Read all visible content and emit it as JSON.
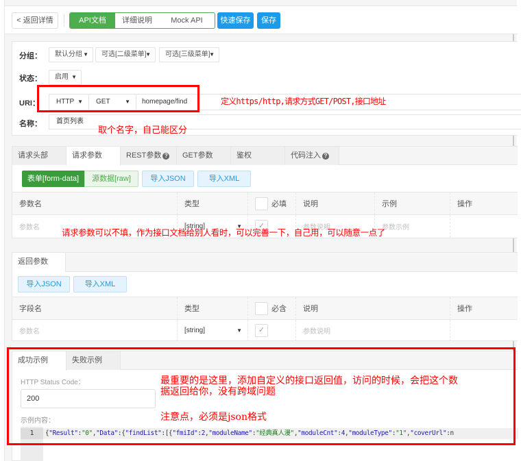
{
  "toolbar": {
    "back_label": "< 返回详情",
    "tabs": [
      {
        "label": "API文档",
        "active": true
      },
      {
        "label": "详细说明",
        "active": false
      },
      {
        "label": "Mock API",
        "active": false
      }
    ],
    "quick_save_label": "快速保存",
    "save_label": "保存"
  },
  "form": {
    "group_label": "分组：",
    "group_selects": [
      "默认分组",
      "可选[二级菜单]",
      "可选[三级菜单]"
    ],
    "status_label": "状态：",
    "status_value": "启用",
    "uri_label": "URI：",
    "protocol": "HTTP",
    "method": "GET",
    "path": "homepage/find",
    "name_label": "名称：",
    "name_value": "首页列表"
  },
  "request": {
    "tabs": [
      {
        "label": "请求头部",
        "help": false,
        "active": false
      },
      {
        "label": "请求参数",
        "help": false,
        "active": true
      },
      {
        "label": "REST参数",
        "help": true,
        "active": false
      },
      {
        "label": "GET参数",
        "help": false,
        "active": false
      },
      {
        "label": "鉴权",
        "help": false,
        "active": false
      },
      {
        "label": "代码注入",
        "help": true,
        "active": false
      }
    ],
    "help_glyph": "?",
    "form_data_label": "表单[form-data]",
    "raw_label": "源数据[raw]",
    "import_json_label": "导入JSON",
    "import_xml_label": "导入XML",
    "columns": [
      "参数名",
      "类型",
      "必填",
      "说明",
      "示例",
      "操作"
    ],
    "row": {
      "name_placeholder": "参数名",
      "type": "[string]",
      "required_check": "✓",
      "desc_placeholder": "参数说明",
      "example_placeholder": "参数示例"
    }
  },
  "response": {
    "tab_label": "返回参数",
    "import_json_label": "导入JSON",
    "import_xml_label": "导入XML",
    "columns": [
      "字段名",
      "类型",
      "必含",
      "说明",
      "操作"
    ],
    "row": {
      "name_placeholder": "参数名",
      "type": "[string]",
      "required_check": "✓",
      "desc_placeholder": "参数说明"
    }
  },
  "example": {
    "tabs": [
      {
        "label": "成功示例",
        "active": true
      },
      {
        "label": "失败示例",
        "active": false
      }
    ],
    "status_code_label": "HTTP Status Code：",
    "status_code_value": "200",
    "content_label": "示例内容：",
    "line_number": "1",
    "code_tokens": [
      {
        "t": "{",
        "c": "pun"
      },
      {
        "t": "\"Result\"",
        "c": "key"
      },
      {
        "t": ":",
        "c": "pun"
      },
      {
        "t": "\"0\"",
        "c": "str"
      },
      {
        "t": ",",
        "c": "pun"
      },
      {
        "t": "\"Data\"",
        "c": "key"
      },
      {
        "t": ":{",
        "c": "pun"
      },
      {
        "t": "\"findList\"",
        "c": "key"
      },
      {
        "t": ":[{",
        "c": "pun"
      },
      {
        "t": "\"fmiId\"",
        "c": "key"
      },
      {
        "t": ":",
        "c": "pun"
      },
      {
        "t": "2",
        "c": "num"
      },
      {
        "t": ",",
        "c": "pun"
      },
      {
        "t": "\"moduleName\"",
        "c": "key"
      },
      {
        "t": ":",
        "c": "pun"
      },
      {
        "t": "\"经典真人漫\"",
        "c": "str"
      },
      {
        "t": ",",
        "c": "pun"
      },
      {
        "t": "\"moduleCnt\"",
        "c": "key"
      },
      {
        "t": ":",
        "c": "pun"
      },
      {
        "t": "4",
        "c": "num"
      },
      {
        "t": ",",
        "c": "pun"
      },
      {
        "t": "\"moduleType\"",
        "c": "key"
      },
      {
        "t": ":",
        "c": "pun"
      },
      {
        "t": "\"1\"",
        "c": "str"
      },
      {
        "t": ",",
        "c": "pun"
      },
      {
        "t": "\"coverUrl\"",
        "c": "key"
      },
      {
        "t": ":n",
        "c": "pun"
      }
    ]
  },
  "annotations": {
    "uri_note": "定义https/http,请求方式GET/POST,接口地址",
    "name_note": "取个名字，自己能区分",
    "params_note": "请求参数可以不填，作为接口文档给别人看时，可以完善一下，自己用，可以随意一点了",
    "example_note_line1": "最重要的是这里，添加自定义的接口返回值，访问的时候，会把这个数",
    "example_note_line2": "据返回给你，没有跨域问题",
    "json_note": "注意点，必须是json格式",
    "color": "#ff0000"
  },
  "colors": {
    "green": "#4cae4c",
    "blue": "#1e9be8",
    "annotation_red": "#ff0000"
  }
}
